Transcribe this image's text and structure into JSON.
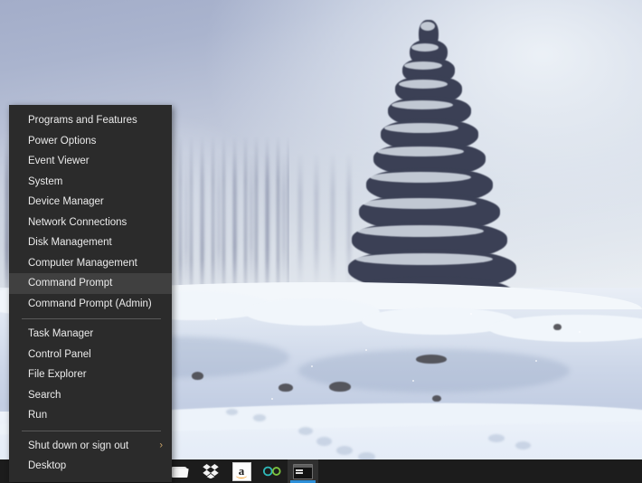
{
  "desktop": {
    "wallpaper_description": "Snowy winter landscape with a snow-covered spruce tree, snow bank and misty forest",
    "colors": {
      "sky_top": "#a3adc9",
      "sky_bottom": "#f2f5f8",
      "snow": "#e9eef6",
      "tree": "#3b4055",
      "taskbar": "#1c1c1c",
      "menu_bg": "#2b2b2b",
      "menu_highlight": "#404040",
      "menu_text": "#ebebeb",
      "separator": "#5a5a5a",
      "accent": "#2c8fd8",
      "amazon_orange": "#f59c24",
      "chevron": "#c9a46a"
    }
  },
  "winx_menu": {
    "name": "power-user-menu",
    "groups": [
      {
        "items": [
          {
            "label": "Programs and Features",
            "highlighted": false,
            "submenu": false
          },
          {
            "label": "Power Options",
            "highlighted": false,
            "submenu": false
          },
          {
            "label": "Event Viewer",
            "highlighted": false,
            "submenu": false
          },
          {
            "label": "System",
            "highlighted": false,
            "submenu": false
          },
          {
            "label": "Device Manager",
            "highlighted": false,
            "submenu": false
          },
          {
            "label": "Network Connections",
            "highlighted": false,
            "submenu": false
          },
          {
            "label": "Disk Management",
            "highlighted": false,
            "submenu": false
          },
          {
            "label": "Computer Management",
            "highlighted": false,
            "submenu": false
          },
          {
            "label": "Command Prompt",
            "highlighted": true,
            "submenu": false
          },
          {
            "label": "Command Prompt (Admin)",
            "highlighted": false,
            "submenu": false
          }
        ]
      },
      {
        "items": [
          {
            "label": "Task Manager",
            "highlighted": false,
            "submenu": false
          },
          {
            "label": "Control Panel",
            "highlighted": false,
            "submenu": false
          },
          {
            "label": "File Explorer",
            "highlighted": false,
            "submenu": false
          },
          {
            "label": "Search",
            "highlighted": false,
            "submenu": false
          },
          {
            "label": "Run",
            "highlighted": false,
            "submenu": false
          }
        ]
      },
      {
        "items": [
          {
            "label": "Shut down or sign out",
            "highlighted": false,
            "submenu": true,
            "chevron": "›"
          },
          {
            "label": "Desktop",
            "highlighted": false,
            "submenu": false
          }
        ]
      }
    ]
  },
  "taskbar": {
    "buttons": [
      {
        "name": "file-explorer",
        "icon": "folder-icon",
        "label": "File Explorer",
        "active": false
      },
      {
        "name": "dropbox",
        "icon": "dropbox-icon",
        "label": "Dropbox",
        "active": false
      },
      {
        "name": "amazon",
        "icon": "amazon-icon",
        "label": "Amazon",
        "active": false,
        "glyph": "a"
      },
      {
        "name": "loop-app",
        "icon": "infinity-loop-icon",
        "label": "Loop",
        "active": false
      },
      {
        "name": "command-prompt",
        "icon": "command-prompt-icon",
        "label": "Command Prompt",
        "active": true
      }
    ]
  }
}
